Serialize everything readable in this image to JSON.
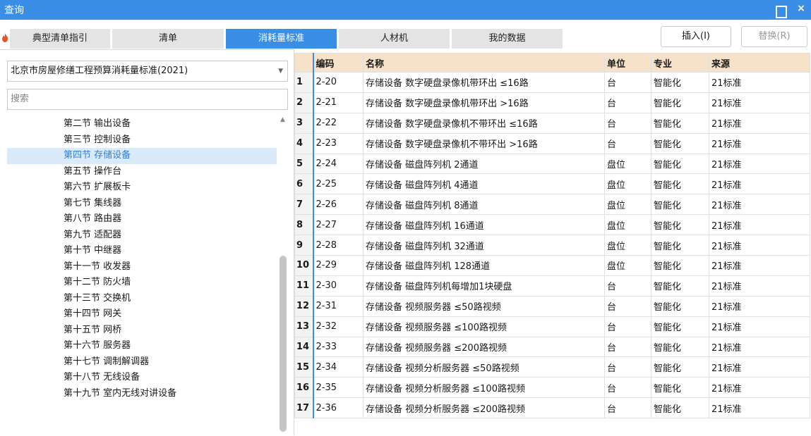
{
  "window": {
    "title": "查询",
    "restore_icon": "restore-icon",
    "close_label": "×"
  },
  "tabs": [
    {
      "label": "典型清单指引"
    },
    {
      "label": "清单"
    },
    {
      "label": "消耗量标准"
    },
    {
      "label": "人材机"
    },
    {
      "label": "我的数据"
    }
  ],
  "active_tab": "消耗量标准",
  "toolbar": {
    "insert_label": "插入(I)",
    "replace_label": "替换(R)"
  },
  "left": {
    "standard_select": "北京市房屋修缮工程预算消耗量标准(2021)",
    "search_placeholder": "搜索",
    "tree": [
      "第二节 输出设备",
      "第三节 控制设备",
      "第四节 存储设备",
      "第五节 操作台",
      "第六节 扩展板卡",
      "第七节 集线器",
      "第八节 路由器",
      "第九节 适配器",
      "第十节 中继器",
      "第十一节 收发器",
      "第十二节 防火墙",
      "第十三节 交换机",
      "第十四节 网关",
      "第十五节 网桥",
      "第十六节 服务器",
      "第十七节 调制解调器",
      "第十八节 无线设备",
      "第十九节 室内无线对讲设备"
    ],
    "selected_item": "第四节 存储设备"
  },
  "table": {
    "headers": {
      "code": "编码",
      "name": "名称",
      "unit": "单位",
      "specialty": "专业",
      "source": "来源"
    },
    "rows": [
      {
        "n": "1",
        "code": "2-20",
        "name": "存储设备 数字硬盘录像机带环出 ≤16路",
        "unit": "台",
        "specialty": "智能化",
        "source": "21标准"
      },
      {
        "n": "2",
        "code": "2-21",
        "name": "存储设备 数字硬盘录像机带环出 >16路",
        "unit": "台",
        "specialty": "智能化",
        "source": "21标准"
      },
      {
        "n": "3",
        "code": "2-22",
        "name": "存储设备 数字硬盘录像机不带环出 ≤16路",
        "unit": "台",
        "specialty": "智能化",
        "source": "21标准"
      },
      {
        "n": "4",
        "code": "2-23",
        "name": "存储设备 数字硬盘录像机不带环出 >16路",
        "unit": "台",
        "specialty": "智能化",
        "source": "21标准"
      },
      {
        "n": "5",
        "code": "2-24",
        "name": "存储设备 磁盘阵列机 2通道",
        "unit": "盘位",
        "specialty": "智能化",
        "source": "21标准"
      },
      {
        "n": "6",
        "code": "2-25",
        "name": "存储设备 磁盘阵列机 4通道",
        "unit": "盘位",
        "specialty": "智能化",
        "source": "21标准"
      },
      {
        "n": "7",
        "code": "2-26",
        "name": "存储设备 磁盘阵列机 8通道",
        "unit": "盘位",
        "specialty": "智能化",
        "source": "21标准"
      },
      {
        "n": "8",
        "code": "2-27",
        "name": "存储设备 磁盘阵列机 16通道",
        "unit": "盘位",
        "specialty": "智能化",
        "source": "21标准"
      },
      {
        "n": "9",
        "code": "2-28",
        "name": "存储设备 磁盘阵列机 32通道",
        "unit": "盘位",
        "specialty": "智能化",
        "source": "21标准"
      },
      {
        "n": "10",
        "code": "2-29",
        "name": "存储设备 磁盘阵列机 128通道",
        "unit": "盘位",
        "specialty": "智能化",
        "source": "21标准"
      },
      {
        "n": "11",
        "code": "2-30",
        "name": "存储设备 磁盘阵列机每增加1块硬盘",
        "unit": "台",
        "specialty": "智能化",
        "source": "21标准"
      },
      {
        "n": "12",
        "code": "2-31",
        "name": "存储设备 视频服务器 ≤50路视频",
        "unit": "台",
        "specialty": "智能化",
        "source": "21标准"
      },
      {
        "n": "13",
        "code": "2-32",
        "name": "存储设备 视频服务器 ≤100路视频",
        "unit": "台",
        "specialty": "智能化",
        "source": "21标准"
      },
      {
        "n": "14",
        "code": "2-33",
        "name": "存储设备 视频服务器 ≤200路视频",
        "unit": "台",
        "specialty": "智能化",
        "source": "21标准"
      },
      {
        "n": "15",
        "code": "2-34",
        "name": "存储设备 视频分析服务器 ≤50路视频",
        "unit": "台",
        "specialty": "智能化",
        "source": "21标准"
      },
      {
        "n": "16",
        "code": "2-35",
        "name": "存储设备 视频分析服务器 ≤100路视频",
        "unit": "台",
        "specialty": "智能化",
        "source": "21标准"
      },
      {
        "n": "17",
        "code": "2-36",
        "name": "存储设备 视频分析服务器 ≤200路视频",
        "unit": "台",
        "specialty": "智能化",
        "source": "21标准"
      }
    ]
  },
  "colors": {
    "accent": "#3a8ee6",
    "header_bg": "#f6e2c8",
    "selected_bg": "#dbeaf8"
  }
}
